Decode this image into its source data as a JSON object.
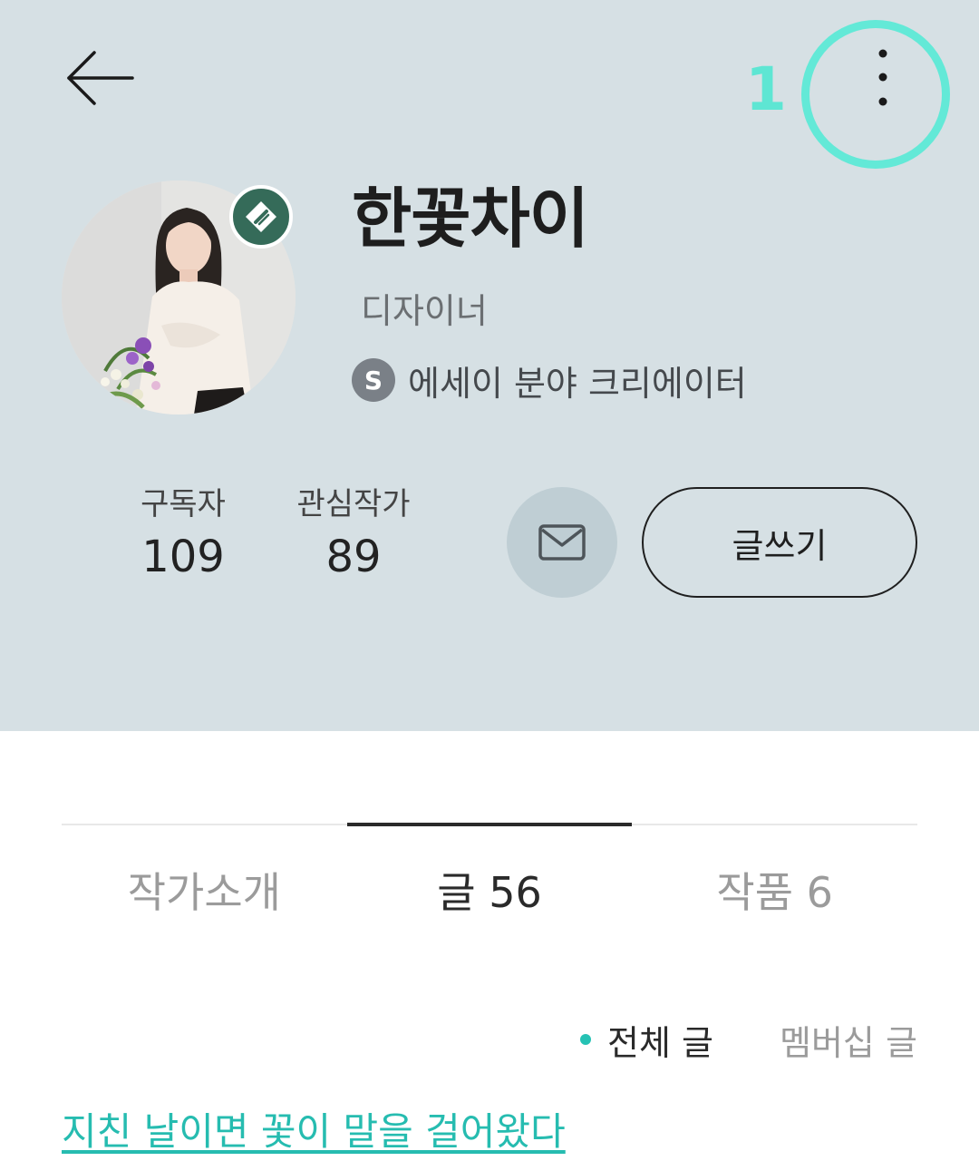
{
  "header": {
    "back_icon": "arrow-left-icon",
    "more_icon": "more-vertical-icon",
    "annotation_number": "1",
    "annotation_color": "#63e9d7",
    "background_color": "#d6e0e4"
  },
  "profile": {
    "name": "한꽃차이",
    "role": "디자이너",
    "badge_icon": "verified-writer-badge-icon",
    "creator_icon_letter": "S",
    "creator_label": "에세이 분야 크리에이터"
  },
  "stats": {
    "subscribers_label": "구독자",
    "subscribers_value": "109",
    "following_label": "관심작가",
    "following_value": "89"
  },
  "actions": {
    "mail_icon": "envelope-icon",
    "write_label": "글쓰기"
  },
  "tabs": [
    {
      "label": "작가소개",
      "active": false
    },
    {
      "label": "글 56",
      "active": true
    },
    {
      "label": "작품 6",
      "active": false
    }
  ],
  "filters": {
    "all_label": "전체 글",
    "membership_label": "멤버십 글",
    "accent_color": "#25c2b4"
  },
  "posts": [
    {
      "title": "지친 날이면 꽃이 말을 걸어왔다"
    }
  ]
}
